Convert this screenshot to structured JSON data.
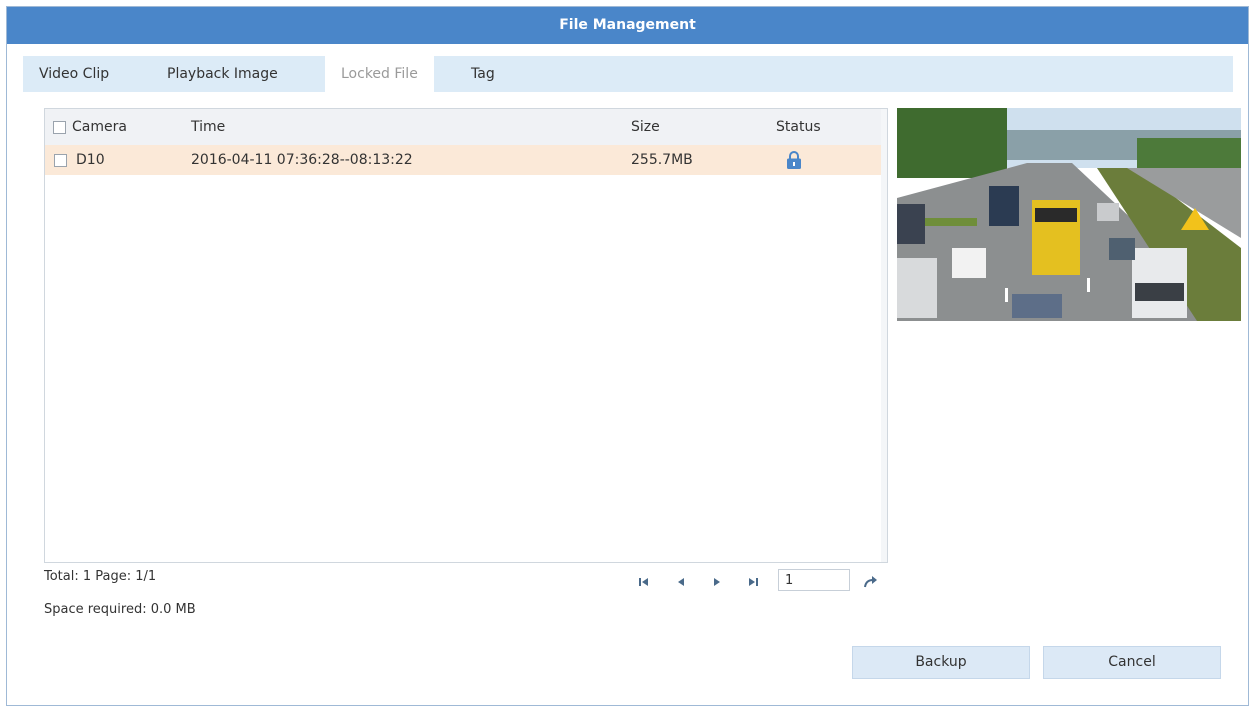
{
  "dialog": {
    "title": "File Management"
  },
  "tabs": [
    {
      "label": "Video Clip",
      "active": false
    },
    {
      "label": "Playback Image",
      "active": false
    },
    {
      "label": "Locked File",
      "active": true
    },
    {
      "label": "Tag",
      "active": false
    }
  ],
  "table": {
    "columns": [
      "Camera",
      "Time",
      "Size",
      "Status"
    ],
    "rows": [
      {
        "camera": "D10",
        "time": "2016-04-11 07:36:28--08:13:22",
        "size": "255.7MB",
        "status_icon": "lock-icon",
        "selected": true,
        "checked": false
      }
    ]
  },
  "footer": {
    "total": "Total: 1  Page: 1/1",
    "space": "Space required: 0.0 MB",
    "page_input_value": "1"
  },
  "buttons": {
    "backup": "Backup",
    "cancel": "Cancel"
  },
  "colors": {
    "titlebar": "#4a86c9",
    "tabbar": "#dcebf7",
    "row_selected": "#fbe9d8",
    "lock": "#4a86c9",
    "button": "#dce9f6"
  }
}
